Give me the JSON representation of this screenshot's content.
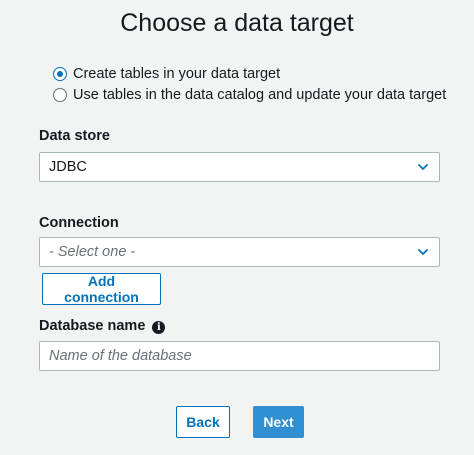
{
  "page": {
    "title": "Choose a data target"
  },
  "target_options": [
    {
      "label": "Create tables in your data target",
      "selected": true
    },
    {
      "label": "Use tables in the data catalog and update your data target",
      "selected": false
    }
  ],
  "data_store": {
    "label": "Data store",
    "value": "JDBC"
  },
  "connection": {
    "label": "Connection",
    "placeholder": "- Select one -",
    "add_button": "Add connection"
  },
  "database_name": {
    "label": "Database name",
    "placeholder": "Name of the database",
    "info_icon": "info-icon"
  },
  "footer": {
    "back_label": "Back",
    "next_label": "Next"
  },
  "colors": {
    "accent": "#0073bb",
    "primary_button": "#2f8fd0",
    "background": "#f2f3f3"
  }
}
